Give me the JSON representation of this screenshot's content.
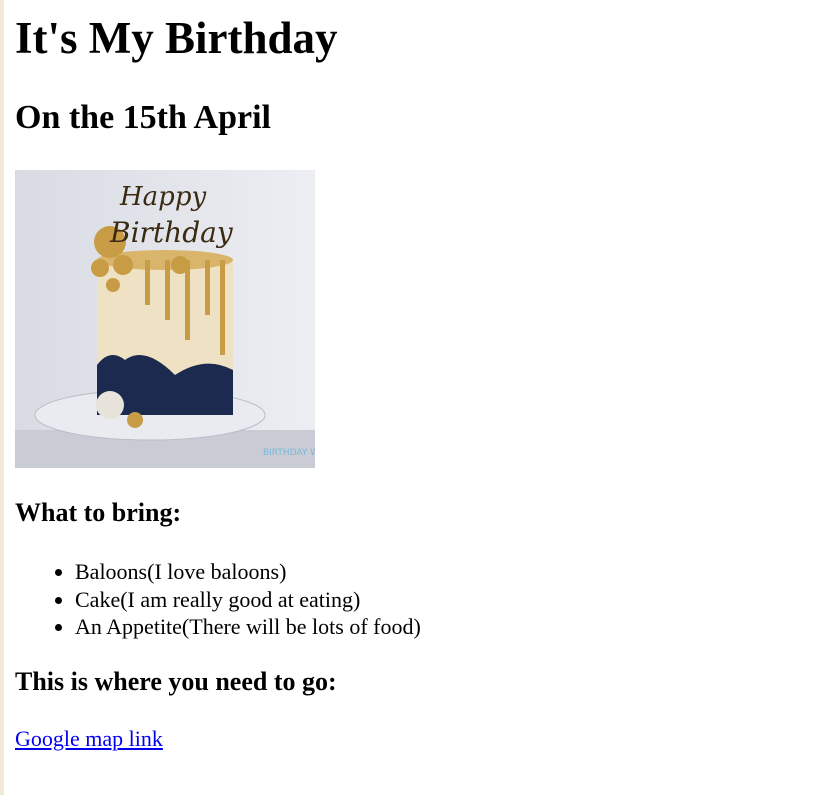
{
  "page": {
    "title": "It's My Birthday",
    "subtitle": "On the 15th April",
    "image": {
      "alt": "Birthday cake",
      "topper_text": "Happy Birthday",
      "watermark": "BIRTHDAY WISHES"
    },
    "bring_heading": "What to bring:",
    "bring_items": [
      "Baloons(I love baloons)",
      "Cake(I am really good at eating)",
      "An Appetite(There will be lots of food)"
    ],
    "location_heading": "This is where you need to go:",
    "map_link": "Google map link"
  },
  "colors": {
    "link": "#0000ee",
    "edge": "#f3ead6"
  }
}
